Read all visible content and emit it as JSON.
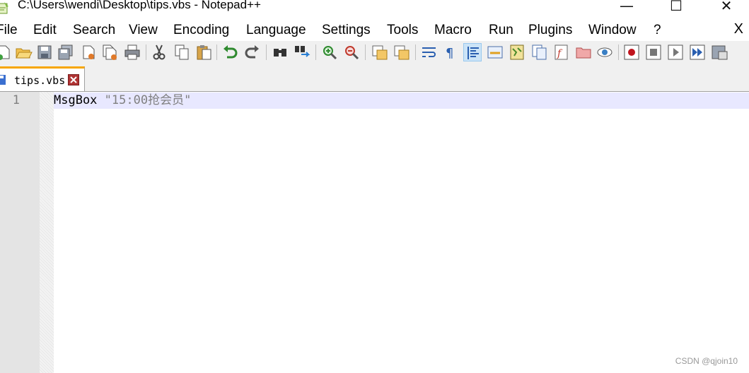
{
  "window": {
    "title": "C:\\Users\\wendi\\Desktop\\tips.vbs - Notepad++",
    "minimize_glyph": "—",
    "maximize_glyph": "☐",
    "close_glyph": "✕"
  },
  "menu": {
    "items": [
      "File",
      "Edit",
      "Search",
      "View",
      "Encoding",
      "Language",
      "Settings",
      "Tools",
      "Macro",
      "Run",
      "Plugins",
      "Window",
      "?"
    ],
    "close_doc_glyph": "X"
  },
  "toolbar": {
    "icons": [
      "new-file-icon",
      "open-folder-icon",
      "save-icon",
      "save-all-icon",
      "close-icon",
      "close-all-icon",
      "print-icon",
      "cut-icon",
      "copy-icon",
      "paste-icon",
      "undo-icon",
      "redo-icon",
      "find-icon",
      "replace-icon",
      "zoom-in-icon",
      "zoom-out-icon",
      "sync-vertical-icon",
      "sync-horizontal-icon",
      "word-wrap-icon",
      "show-all-characters-icon",
      "indent-guide-icon",
      "user-defined-language-icon",
      "document-map-icon",
      "document-list-icon",
      "function-list-icon",
      "folder-as-workspace-icon",
      "monitoring-icon",
      "record-macro-icon",
      "stop-recording-icon",
      "playback-macro-icon",
      "run-macro-multiple-icon",
      "save-macro-icon"
    ]
  },
  "tabs": [
    {
      "label": "tips.vbs",
      "active": true
    }
  ],
  "editor": {
    "line_numbers": [
      "1"
    ],
    "lines": [
      {
        "keyword": "MsgBox",
        "string": "\"15:00抢会员\""
      }
    ]
  },
  "watermark": "CSDN @qjoin10",
  "colors": {
    "tab_accent": "#f7a600",
    "current_line": "#e8e8ff",
    "gutter": "#e4e4e4",
    "string": "#808080"
  }
}
